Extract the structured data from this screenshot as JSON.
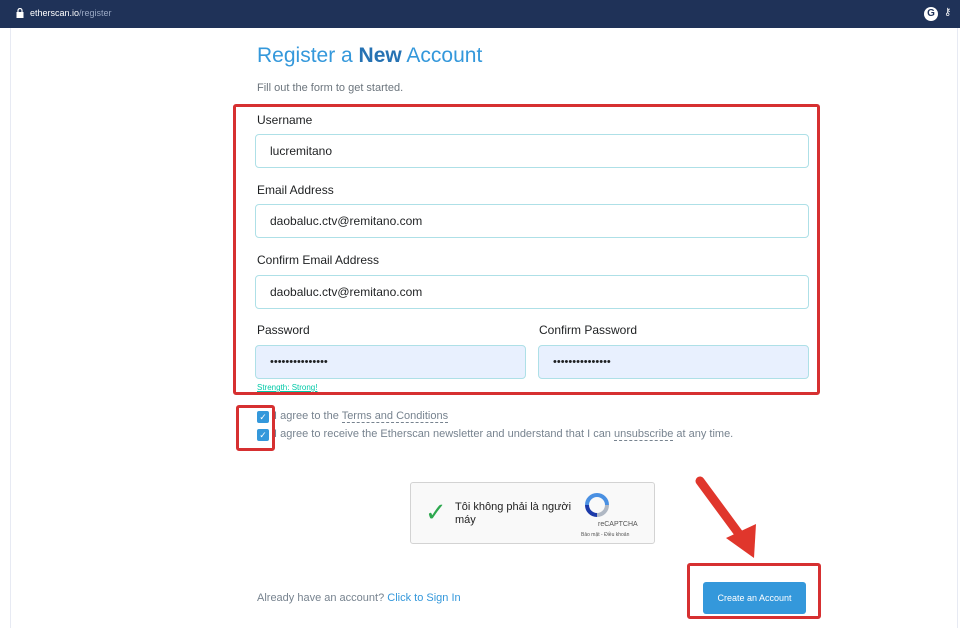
{
  "browser": {
    "url_domain": "etherscan.io",
    "url_path": "/register"
  },
  "header": {
    "title_prefix": "Register a ",
    "title_bold": "New",
    "title_suffix": " Account",
    "subtitle": "Fill out the form to get started."
  },
  "form": {
    "username_label": "Username",
    "username_value": "lucremitano",
    "email_label": "Email Address",
    "email_value": "daobaluc.ctv@remitano.com",
    "confirm_email_label": "Confirm Email Address",
    "confirm_email_value": "daobaluc.ctv@remitano.com",
    "password_label": "Password",
    "password_value": "•••••••••••••••",
    "confirm_password_label": "Confirm Password",
    "confirm_password_value": "•••••••••••••••",
    "strength_text": "Strength: Strong!"
  },
  "agreements": {
    "terms_prefix": "I agree to the ",
    "terms_link": "Terms and Conditions",
    "newsletter_prefix": "I agree to receive the Etherscan newsletter and understand that I can ",
    "newsletter_link": "unsubscribe",
    "newsletter_suffix": " at any time.",
    "terms_checked": true,
    "newsletter_checked": true
  },
  "captcha": {
    "text": "Tôi không phải là người máy",
    "brand": "reCAPTCHA",
    "terms": "Bảo mật - Điều khoản"
  },
  "footer": {
    "signin_prefix": "Already have an account? ",
    "signin_link": "Click to Sign In",
    "submit_label": "Create an Account"
  },
  "colors": {
    "accent": "#3498db",
    "annotation": "#d63031",
    "topbar": "#1f3258"
  }
}
